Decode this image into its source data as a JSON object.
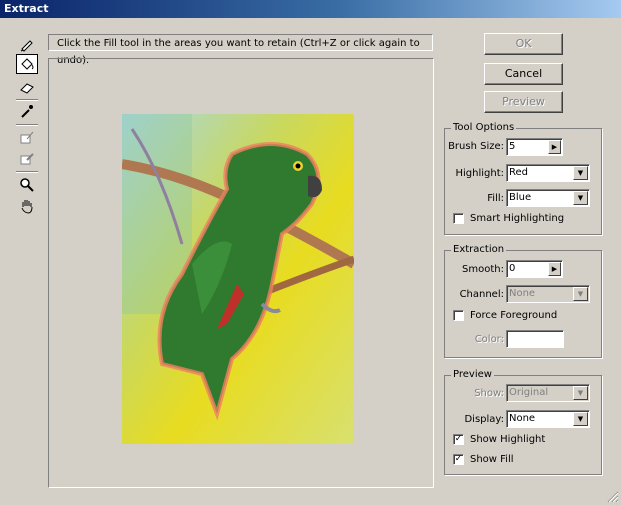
{
  "window": {
    "title": "Extract"
  },
  "instruction": "Click the Fill tool in the areas you want to retain (Ctrl+Z or click again to undo).",
  "tools": [
    {
      "name": "edge-highlighter-icon"
    },
    {
      "name": "fill-icon",
      "active": true
    },
    {
      "name": "eraser-icon"
    },
    {
      "name": "eyedropper-icon"
    },
    {
      "name": "cleanup-tool-icon"
    },
    {
      "name": "edge-touchup-icon"
    },
    {
      "name": "zoom-icon"
    },
    {
      "name": "hand-icon"
    }
  ],
  "buttons": {
    "ok": "OK",
    "cancel": "Cancel",
    "preview": "Preview"
  },
  "tool_options": {
    "title": "Tool Options",
    "brush_size_label": "Brush Size:",
    "brush_size_value": "5",
    "highlight_label": "Highlight:",
    "highlight_value": "Red",
    "fill_label": "Fill:",
    "fill_value": "Blue",
    "smart_highlighting_label": "Smart Highlighting",
    "smart_highlighting_checked": false
  },
  "extraction": {
    "title": "Extraction",
    "smooth_label": "Smooth:",
    "smooth_value": "0",
    "channel_label": "Channel:",
    "channel_value": "None",
    "force_foreground_label": "Force Foreground",
    "force_foreground_checked": false,
    "color_label": "Color:"
  },
  "preview": {
    "title": "Preview",
    "show_label": "Show:",
    "show_value": "Original",
    "display_label": "Display:",
    "display_value": "None",
    "show_highlight_label": "Show Highlight",
    "show_highlight_checked": true,
    "show_fill_label": "Show Fill",
    "show_fill_checked": true
  },
  "colors": {
    "highlight": "#f08060",
    "parrot": "#2e7d32"
  }
}
